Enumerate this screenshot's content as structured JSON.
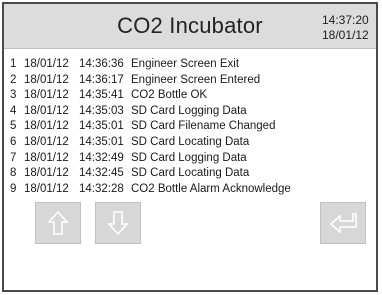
{
  "header": {
    "title": "CO2 Incubator",
    "time": "14:37:20",
    "date": "18/01/12"
  },
  "log": [
    {
      "num": "1",
      "date": "18/01/12",
      "time": "14:36:36",
      "message": "Engineer Screen Exit"
    },
    {
      "num": "2",
      "date": "18/01/12",
      "time": "14:36:17",
      "message": "Engineer Screen Entered"
    },
    {
      "num": "3",
      "date": "18/01/12",
      "time": "14:35:41",
      "message": "CO2 Bottle OK"
    },
    {
      "num": "4",
      "date": "18/01/12",
      "time": "14:35:03",
      "message": "SD Card Logging Data"
    },
    {
      "num": "5",
      "date": "18/01/12",
      "time": "14:35:01",
      "message": "SD Card Filename Changed"
    },
    {
      "num": "6",
      "date": "18/01/12",
      "time": "14:35:01",
      "message": "SD Card Locating Data"
    },
    {
      "num": "7",
      "date": "18/01/12",
      "time": "14:32:49",
      "message": "SD Card Logging Data"
    },
    {
      "num": "8",
      "date": "18/01/12",
      "time": "14:32:45",
      "message": "SD Card Locating Data"
    },
    {
      "num": "9",
      "date": "18/01/12",
      "time": "14:32:28",
      "message": "CO2 Bottle Alarm Acknowledge"
    }
  ],
  "buttons": {
    "up_icon": "arrow-up-icon",
    "down_icon": "arrow-down-icon",
    "enter_icon": "enter-return-icon"
  },
  "colors": {
    "header_bg": "#dcdcdc",
    "button_bg": "#d7d7d7",
    "border": "#4a4a4a"
  }
}
